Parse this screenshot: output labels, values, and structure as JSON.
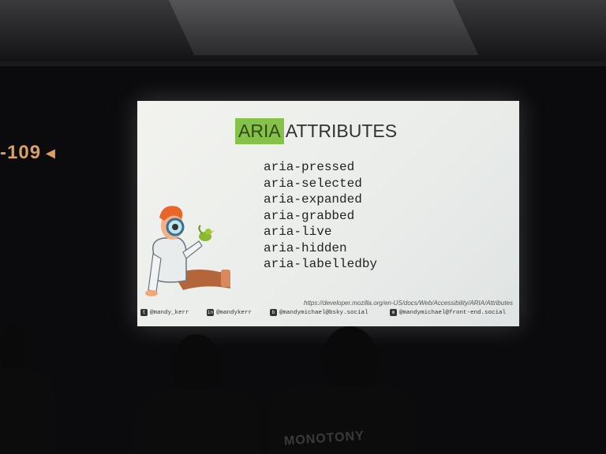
{
  "room_sign": {
    "label": "-109",
    "arrow": "◄"
  },
  "slide": {
    "title_highlight": "ARIA",
    "title_rest": " ATTRIBUTES",
    "attributes": [
      "aria-pressed",
      "aria-selected",
      "aria-expanded",
      "aria-grabbed",
      "aria-live",
      "aria-hidden",
      "aria-labelledby"
    ],
    "url": "https://developer.mozilla.org/en-US/docs/Web/Accessibility/ARIA/Attributes",
    "socials": [
      {
        "icon": "twitter-icon",
        "handle": "@mandy_kerr"
      },
      {
        "icon": "linkedin-icon",
        "handle": "@mandykerr"
      },
      {
        "icon": "bluesky-icon",
        "handle": "@mandymichael@bsky.social"
      },
      {
        "icon": "mastodon-icon",
        "handle": "@mandymichael@front-end.social"
      }
    ],
    "accent_color": "#86c24a"
  },
  "audience": {
    "shirt_text": "MONOTONY"
  }
}
